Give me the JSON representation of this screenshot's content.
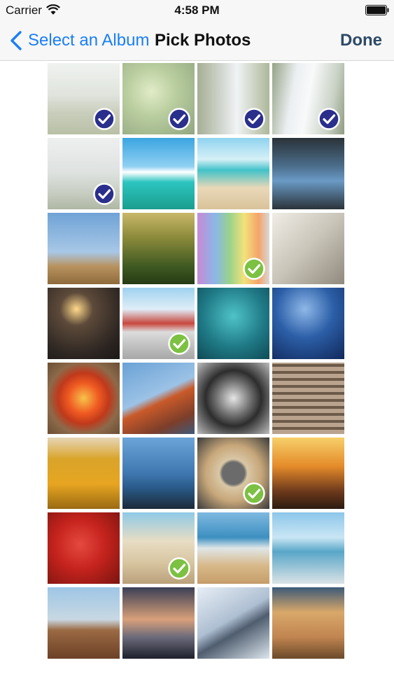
{
  "status_bar": {
    "carrier": "Carrier",
    "time": "4:58 PM",
    "wifi_icon": "wifi-icon",
    "battery_icon": "battery-icon"
  },
  "nav_bar": {
    "back_label": "Select an Album",
    "back_icon": "chevron-left-icon",
    "title": "Pick Photos",
    "done_label": "Done"
  },
  "colors": {
    "accent_blue": "#1a7ff5",
    "done_text": "#2d4a66",
    "check_selected": "#2a2f8c",
    "check_suggested": "#7cc142"
  },
  "photos": [
    {
      "subject": "field",
      "selected": true,
      "badge": "blue"
    },
    {
      "subject": "leaves",
      "selected": true,
      "badge": "blue"
    },
    {
      "subject": "waterfall",
      "selected": true,
      "badge": "blue"
    },
    {
      "subject": "waterfall-close",
      "selected": true,
      "badge": "blue"
    },
    {
      "subject": "falls-mist",
      "selected": true,
      "badge": "blue"
    },
    {
      "subject": "tropical-island",
      "selected": false,
      "badge": "none"
    },
    {
      "subject": "beach",
      "selected": false,
      "badge": "none"
    },
    {
      "subject": "car",
      "selected": false,
      "badge": "none"
    },
    {
      "subject": "elephant",
      "selected": false,
      "badge": "none"
    },
    {
      "subject": "forest",
      "selected": false,
      "badge": "none"
    },
    {
      "subject": "child-rainbow",
      "selected": true,
      "badge": "green"
    },
    {
      "subject": "glasses",
      "selected": false,
      "badge": "none"
    },
    {
      "subject": "sparkler",
      "selected": false,
      "badge": "none"
    },
    {
      "subject": "train",
      "selected": true,
      "badge": "green"
    },
    {
      "subject": "fish",
      "selected": false,
      "badge": "none"
    },
    {
      "subject": "bokeh",
      "selected": false,
      "badge": "none"
    },
    {
      "subject": "flower",
      "selected": false,
      "badge": "none"
    },
    {
      "subject": "mountain",
      "selected": false,
      "badge": "none"
    },
    {
      "subject": "glass-ball",
      "selected": false,
      "badge": "none"
    },
    {
      "subject": "building-facade",
      "selected": false,
      "badge": "none"
    },
    {
      "subject": "honey",
      "selected": false,
      "badge": "none"
    },
    {
      "subject": "rocks-sea",
      "selected": false,
      "badge": "none"
    },
    {
      "subject": "bread-heart",
      "selected": true,
      "badge": "green"
    },
    {
      "subject": "sunset-street",
      "selected": false,
      "badge": "none"
    },
    {
      "subject": "strawberries",
      "selected": false,
      "badge": "none"
    },
    {
      "subject": "desert-car",
      "selected": true,
      "badge": "green"
    },
    {
      "subject": "beach-play",
      "selected": false,
      "badge": "none"
    },
    {
      "subject": "running-kids",
      "selected": false,
      "badge": "none"
    },
    {
      "subject": "tribe",
      "selected": false,
      "badge": "none"
    },
    {
      "subject": "fisherman",
      "selected": false,
      "badge": "none"
    },
    {
      "subject": "tire-snow",
      "selected": false,
      "badge": "none"
    },
    {
      "subject": "palace",
      "selected": false,
      "badge": "none"
    }
  ]
}
